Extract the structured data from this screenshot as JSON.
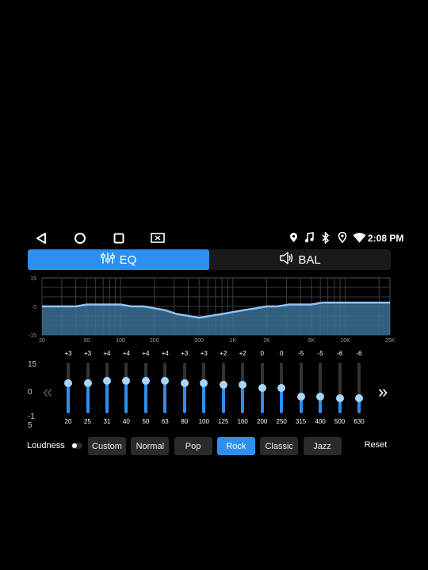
{
  "status_bar": {
    "time": "2:08 PM",
    "icons": [
      "location-pin-icon",
      "music-note-icon",
      "bluetooth-icon",
      "gps-icon",
      "wifi-icon"
    ]
  },
  "nav_bar": {
    "buttons": [
      "back-icon",
      "home-icon",
      "recents-icon",
      "screen-cast-icon"
    ]
  },
  "tabs": [
    {
      "label": "EQ",
      "icon": "equalizer-icon",
      "active": true
    },
    {
      "label": "BAL",
      "icon": "speaker-icon",
      "active": false
    }
  ],
  "colors": {
    "accent": "#2d8ff0",
    "curve_fill": "#3b6e97",
    "curve_line": "#8cc4f5",
    "knob": "#a9d4fb",
    "button_bg": "#2b2b2b"
  },
  "chart_data": {
    "type": "area",
    "y_ticks": [
      "15",
      "0",
      "-15"
    ],
    "ylim": [
      -15,
      15
    ],
    "x_ticks": [
      "20",
      "50",
      "100",
      "200",
      "500",
      "1K",
      "2K",
      "5K",
      "10K",
      "25K"
    ],
    "x_scale": "log",
    "grid": true,
    "series": [
      {
        "x": [
          20,
          25,
          31,
          40,
          50,
          63,
          80,
          100,
          125,
          160,
          200,
          250,
          315,
          400,
          500,
          630,
          800,
          1000,
          1250,
          1600,
          2000,
          2500,
          3150,
          4000,
          5000,
          6300,
          8000,
          10000,
          12500,
          16000,
          20000,
          25000
        ],
        "values": [
          0,
          0,
          0,
          0,
          1,
          1,
          1,
          1,
          0,
          0,
          -1,
          -2,
          -4,
          -5,
          -6,
          -5,
          -4,
          -3,
          -2,
          -1,
          0,
          0,
          1,
          1,
          1,
          2,
          2,
          2,
          2,
          2,
          2,
          2
        ]
      }
    ]
  },
  "equalizer": {
    "y_labels": [
      "15",
      "0",
      "-1",
      "5"
    ],
    "bands": [
      {
        "freq": "20",
        "gain_label": "+3",
        "gain": 3
      },
      {
        "freq": "25",
        "gain_label": "+3",
        "gain": 3
      },
      {
        "freq": "31",
        "gain_label": "+4",
        "gain": 4
      },
      {
        "freq": "40",
        "gain_label": "+4",
        "gain": 4
      },
      {
        "freq": "50",
        "gain_label": "+4",
        "gain": 4
      },
      {
        "freq": "63",
        "gain_label": "+4",
        "gain": 4
      },
      {
        "freq": "80",
        "gain_label": "+3",
        "gain": 3
      },
      {
        "freq": "100",
        "gain_label": "+3",
        "gain": 3
      },
      {
        "freq": "125",
        "gain_label": "+2",
        "gain": 2
      },
      {
        "freq": "160",
        "gain_label": "+2",
        "gain": 2
      },
      {
        "freq": "200",
        "gain_label": "0",
        "gain": 0
      },
      {
        "freq": "250",
        "gain_label": "0",
        "gain": 0
      },
      {
        "freq": "315",
        "gain_label": "-5",
        "gain": -5
      },
      {
        "freq": "400",
        "gain_label": "-5",
        "gain": -5
      },
      {
        "freq": "500",
        "gain_label": "-6",
        "gain": -6
      },
      {
        "freq": "630",
        "gain_label": "-6",
        "gain": -6
      }
    ],
    "prev_arrow": "«",
    "next_arrow": "»"
  },
  "presets": {
    "loudness_label": "Loudness",
    "loudness_on": false,
    "items": [
      "Custom",
      "Normal",
      "Pop",
      "Rock",
      "Classic",
      "Jazz"
    ],
    "selected": "Rock",
    "reset_label": "Reset"
  }
}
